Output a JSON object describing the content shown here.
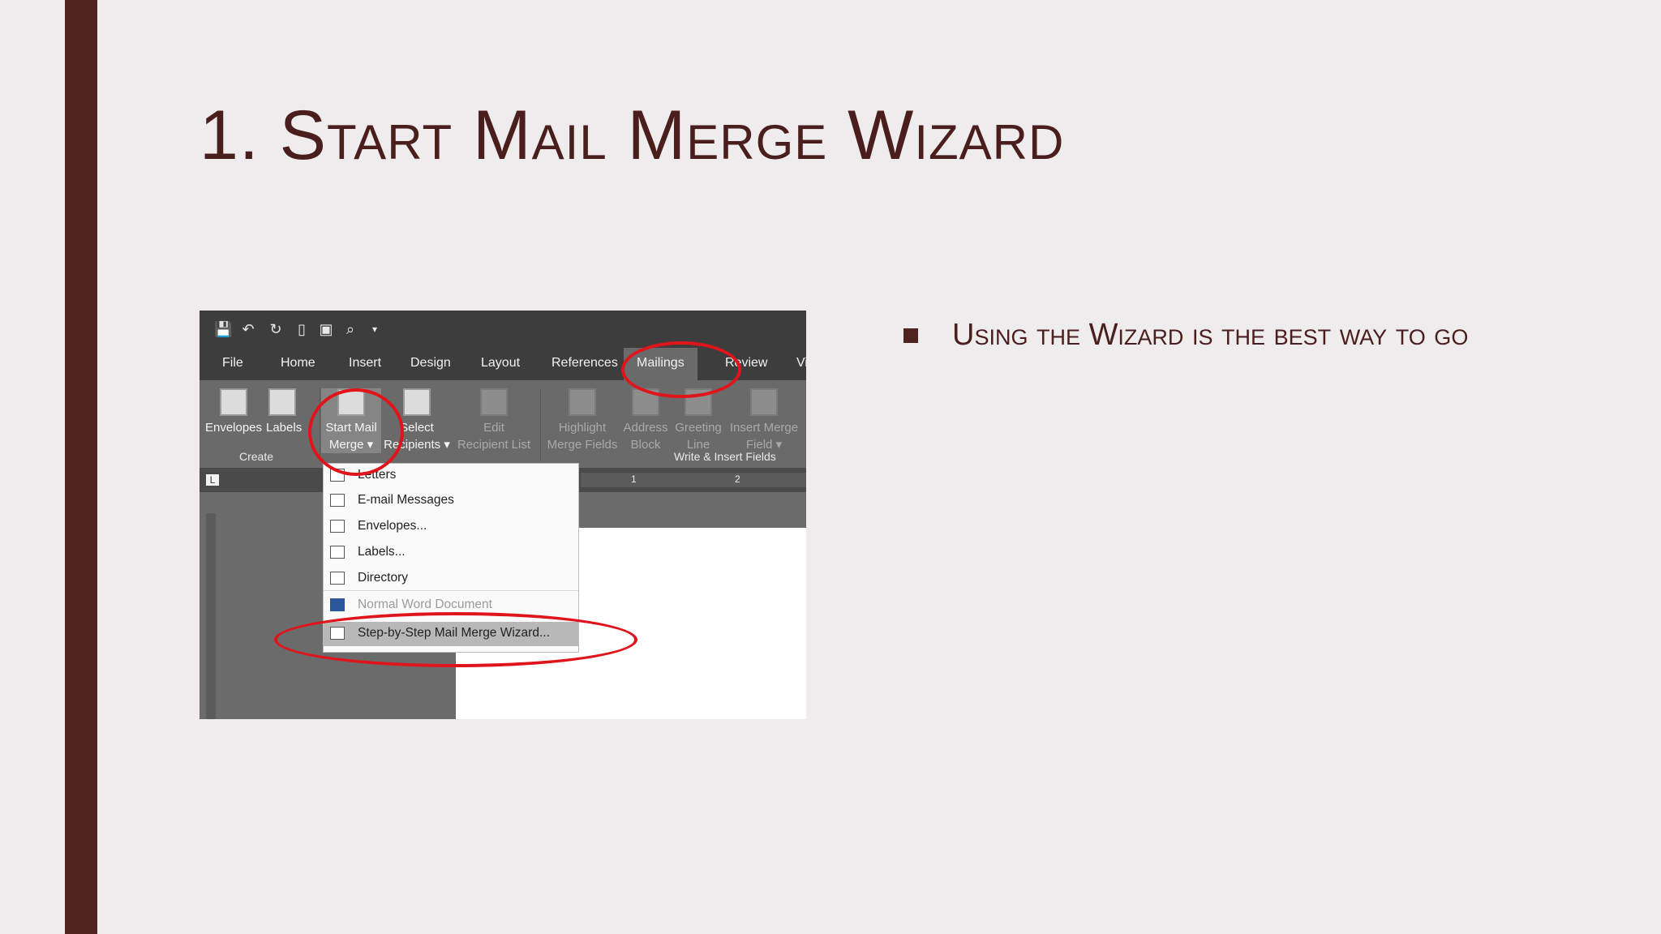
{
  "slide": {
    "title": "1. Start Mail Merge Wizard",
    "bullet": "Using the Wizard is the best way to go"
  },
  "screenshot": {
    "tabs": [
      "File",
      "Home",
      "Insert",
      "Design",
      "Layout",
      "References",
      "Mailings",
      "Review",
      "Vi"
    ],
    "active_tab": "Mailings",
    "ribbon": {
      "envelopes": "Envelopes",
      "labels": "Labels",
      "start_mail_merge_l1": "Start Mail",
      "start_mail_merge_l2": "Merge ▾",
      "select_recipients_l1": "Select",
      "select_recipients_l2": "Recipients ▾",
      "edit_recipient_l1": "Edit",
      "edit_recipient_l2": "Recipient List",
      "highlight_l1": "Highlight",
      "highlight_l2": "Merge Fields",
      "address_l1": "Address",
      "address_l2": "Block",
      "greeting_l1": "Greeting",
      "greeting_l2": "Line",
      "insert_field_l1": "Insert Merge",
      "insert_field_l2": "Field ▾",
      "group_create": "Create",
      "group_write_insert": "Write & Insert Fields"
    },
    "ruler": {
      "corner": "L",
      "marks": [
        "1",
        "2"
      ]
    },
    "dropdown": [
      "Letters",
      "E-mail Messages",
      "Envelopes...",
      "Labels...",
      "Directory",
      "Normal Word Document",
      "Step-by-Step Mail Merge Wizard..."
    ]
  },
  "colors": {
    "accent": "#4f2320",
    "title_text": "#4a1e1c",
    "highlight_circle": "#e0141b",
    "ribbon_bg": "#6a6a6a"
  }
}
